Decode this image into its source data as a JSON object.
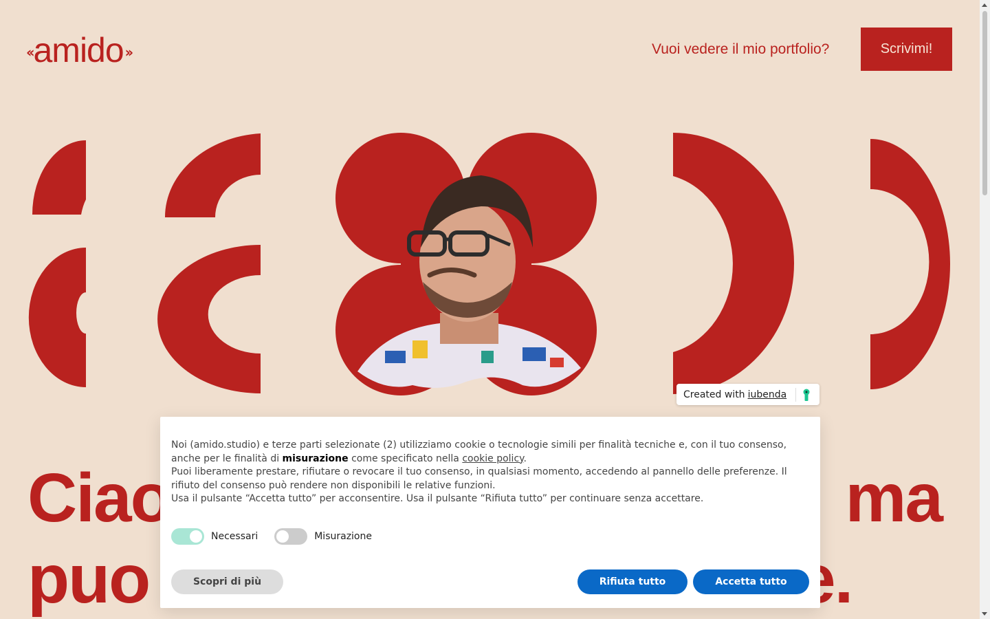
{
  "header": {
    "logo_text": "amido",
    "portfolio_link": "Vuoi vedere il mio portfolio?",
    "cta_label": "Scrivimi!"
  },
  "hero": {
    "headline_line1_left": "Ciao",
    "headline_line1_right": "ma",
    "headline_line2_left": "puo",
    "headline_line2_right": "e."
  },
  "iubenda_badge": {
    "text": "Created with",
    "link": "iubenda"
  },
  "cookie_banner": {
    "p1_a": "Noi (amido.studio) e terze parti selezionate (2) utilizziamo cookie o tecnologie simili per finalità tecniche e, con il tuo consenso, anche per le finalità di",
    "p1_bold": "misurazione",
    "p1_b": "come specificato nella",
    "p1_link": "cookie policy",
    "p1_end": ".",
    "p2": "Puoi liberamente prestare, rifiutare o revocare il tuo consenso, in qualsiasi momento, accedendo al pannello delle preferenze. Il rifiuto del consenso può rendere non disponibili le relative funzioni.",
    "p3": "Usa il pulsante “Accetta tutto” per acconsentire. Usa il pulsante “Rifiuta tutto” per continuare senza accettare.",
    "toggles": [
      {
        "label": "Necessari",
        "state": "on"
      },
      {
        "label": "Misurazione",
        "state": "off"
      }
    ],
    "learn_more": "Scopri di più",
    "reject": "Rifiuta tutto",
    "accept": "Accetta tutto"
  },
  "colors": {
    "brand_red": "#b9221f",
    "background": "#f0dfcf",
    "button_blue": "#0a69c7",
    "toggle_on": "#a9e6d5"
  }
}
